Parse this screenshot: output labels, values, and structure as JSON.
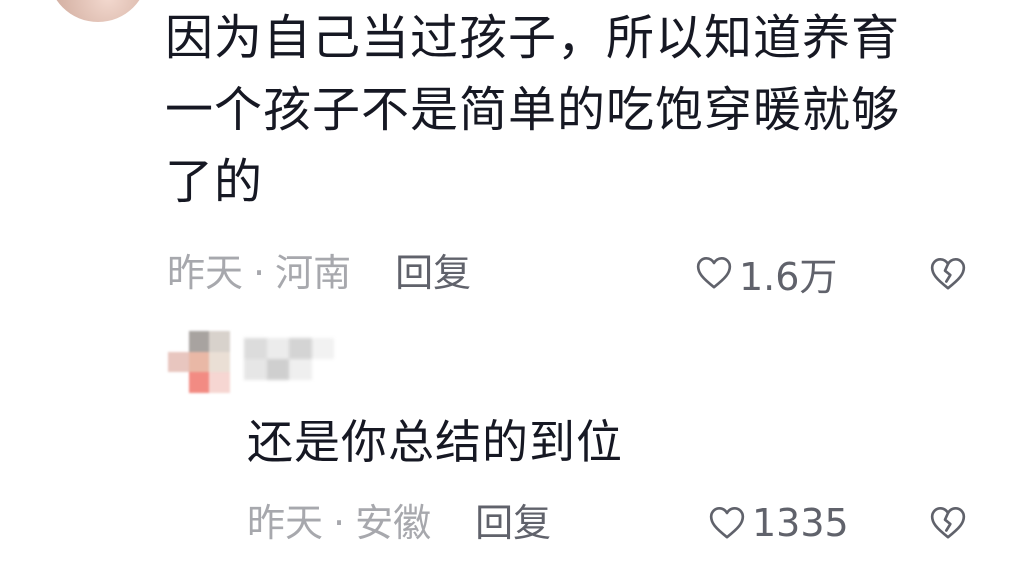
{
  "comment": {
    "text_line1": "因为自己当过孩子，所以知道养育",
    "text_line2": "一个孩子不是简单的吃饱穿暖就够",
    "text_line3": "了的",
    "time": "昨天",
    "separator": "·",
    "location": "河南",
    "reply_label": "回复",
    "like_count": "1.6万"
  },
  "reply": {
    "text": "还是你总结的到位",
    "time": "昨天",
    "separator": "·",
    "location": "安徽",
    "reply_label": "回复",
    "like_count": "1335"
  },
  "icons": {
    "like": "heart-outline-icon",
    "dislike": "broken-heart-icon"
  },
  "colors": {
    "text_primary": "#161823",
    "text_meta": "#a7a8ad",
    "text_action": "#60626b",
    "background": "#ffffff"
  }
}
